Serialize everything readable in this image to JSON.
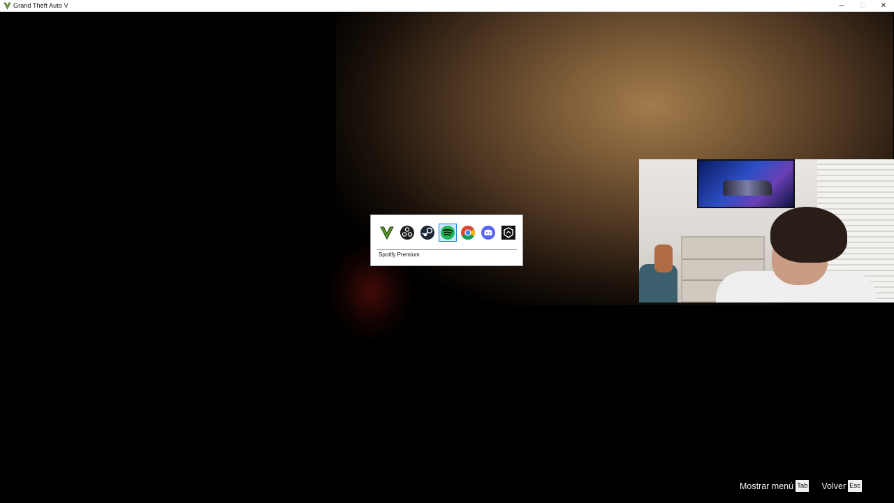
{
  "window": {
    "title": "Grand Theft Auto V",
    "controls": {
      "minimize": "─",
      "maximize": "☐",
      "close": "✕"
    }
  },
  "switcher": {
    "items": [
      {
        "name": "gta-v-icon",
        "selected": false
      },
      {
        "name": "obs-icon",
        "selected": false
      },
      {
        "name": "steam-icon",
        "selected": false
      },
      {
        "name": "spotify-icon",
        "selected": true
      },
      {
        "name": "chrome-icon",
        "selected": false
      },
      {
        "name": "discord-icon",
        "selected": false
      },
      {
        "name": "epic-launcher-icon",
        "selected": false
      }
    ],
    "selected_label": "Spotify Premium"
  },
  "hints": {
    "menu_label": "Mostrar menú",
    "menu_key": "Tab",
    "back_label": "Volver",
    "back_key": "Esc"
  },
  "colors": {
    "spotify_green": "#1db954",
    "discord_blurple": "#5865f2",
    "gta_green": "#5a9a2a"
  }
}
